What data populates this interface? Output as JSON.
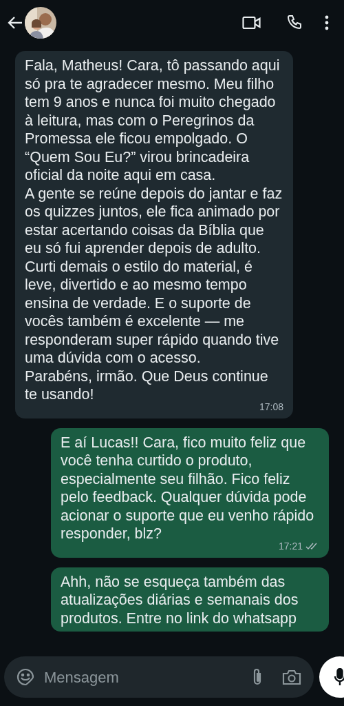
{
  "messages": [
    {
      "kind": "incoming",
      "text": "Fala, Matheus! Cara, tô passando aqui só pra te agradecer mesmo. Meu filho tem 9 anos e nunca foi muito chegado à leitura, mas com o Peregrinos da Promessa ele ficou empolgado. O “Quem Sou Eu?” virou brincadeira oficial da noite aqui em casa.\nA gente se reúne depois do jantar e faz os quizzes juntos, ele fica animado por estar acertando coisas da Bíblia que eu só fui aprender depois de adulto.\nCurti demais o estilo do material, é leve, divertido e ao mesmo tempo ensina de verdade. E o suporte de vocês também é excelente — me responderam super rápido quando tive uma dúvida com o acesso.\nParabéns, irmão. Que Deus continue te usando!",
      "time": "17:08"
    },
    {
      "kind": "outgoing",
      "text": "E aí Lucas!! Cara, fico muito feliz que você tenha curtido o produto, especialmente seu filhão. Fico feliz pelo feedback. Qualquer dúvida pode acionar o suporte que eu venho rápido responder, blz?",
      "time": "17:21",
      "read": true
    },
    {
      "kind": "outgoing",
      "text": "Ahh, não se esqueça também das atualizações diárias e semanais dos produtos. Entre no link do whatsapp"
    }
  ],
  "composer": {
    "placeholder": "Mensagem"
  }
}
